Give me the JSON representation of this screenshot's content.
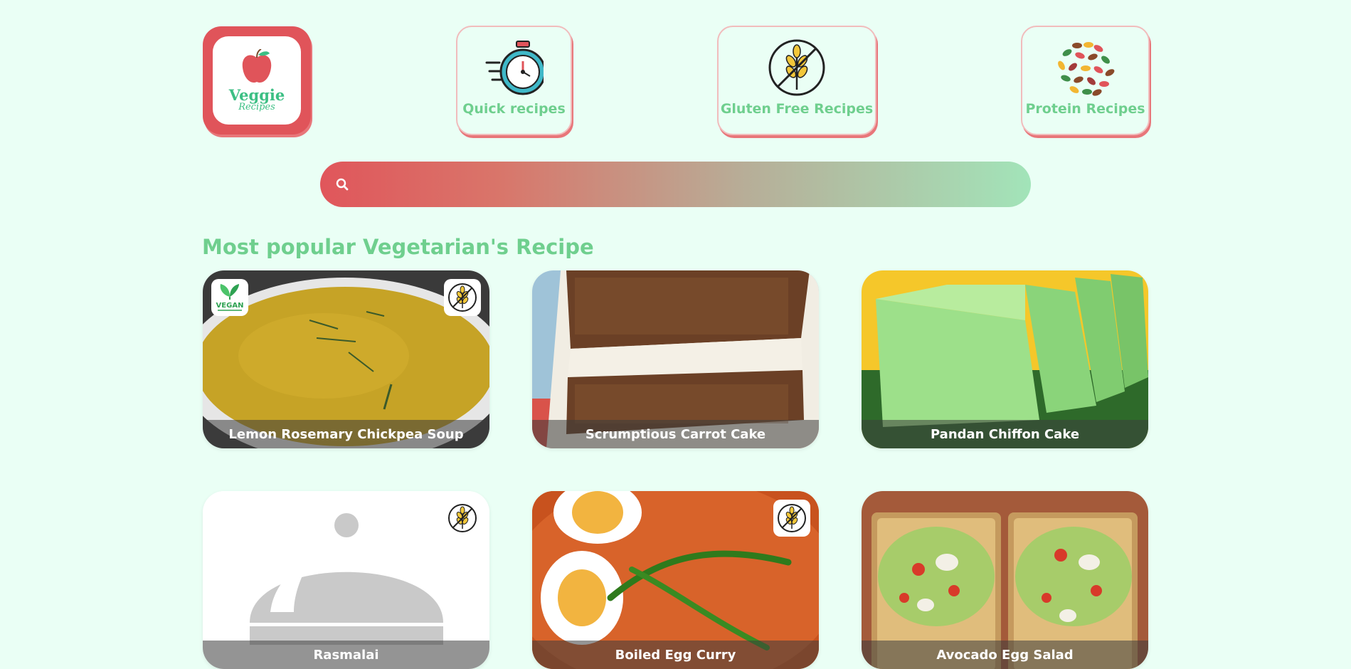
{
  "logo": {
    "title": "Veggie",
    "subtitle": "Recipes"
  },
  "nav": [
    {
      "label": "Quick recipes",
      "icon": "stopwatch-icon"
    },
    {
      "label": "Gluten Free Recipes",
      "icon": "gluten-free-icon"
    },
    {
      "label": "Protein Recipes",
      "icon": "beans-icon"
    }
  ],
  "search": {
    "placeholder": "",
    "icon": "search-icon"
  },
  "section": {
    "title": "Most popular Vegetarian's Recipe"
  },
  "recipes": [
    {
      "title": "Lemon Rosemary Chickpea Soup",
      "badges": [
        "vegan-badge",
        "gluten-free-badge"
      ]
    },
    {
      "title": "Scrumptious Carrot Cake",
      "badges": []
    },
    {
      "title": "Pandan Chiffon Cake",
      "badges": []
    },
    {
      "title": "Rasmalai",
      "badges": [
        "gluten-free-badge"
      ]
    },
    {
      "title": "Boiled Egg Curry",
      "badges": [
        "gluten-free-badge"
      ]
    },
    {
      "title": "Avocado Egg Salad",
      "badges": []
    }
  ],
  "badges": {
    "vegan_text": "VEGAN"
  },
  "colors": {
    "background": "#eafff5",
    "accent_green": "#6fcf8e",
    "accent_red": "#e0545a"
  }
}
